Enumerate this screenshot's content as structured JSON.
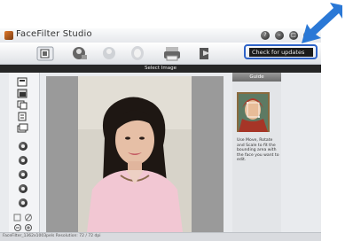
{
  "window": {
    "title": "FaceFilter Studio",
    "controls": [
      "?",
      "–",
      "□",
      "×"
    ]
  },
  "toolbar": {
    "check_updates_label": "Check for updates"
  },
  "header": {
    "title": "Select Image"
  },
  "guide": {
    "title": "Guide",
    "text": "Use Move, Rotate and Scale to fit the bounding area with the face you want to edit."
  },
  "status": {
    "text": "FaceFilter_1362x1003pels   Resolution: 72 / 72 dpi"
  },
  "colors": {
    "callout_arrow": "#2a78d6",
    "callout_ring": "#2e63c8",
    "selbar": "#262626"
  }
}
